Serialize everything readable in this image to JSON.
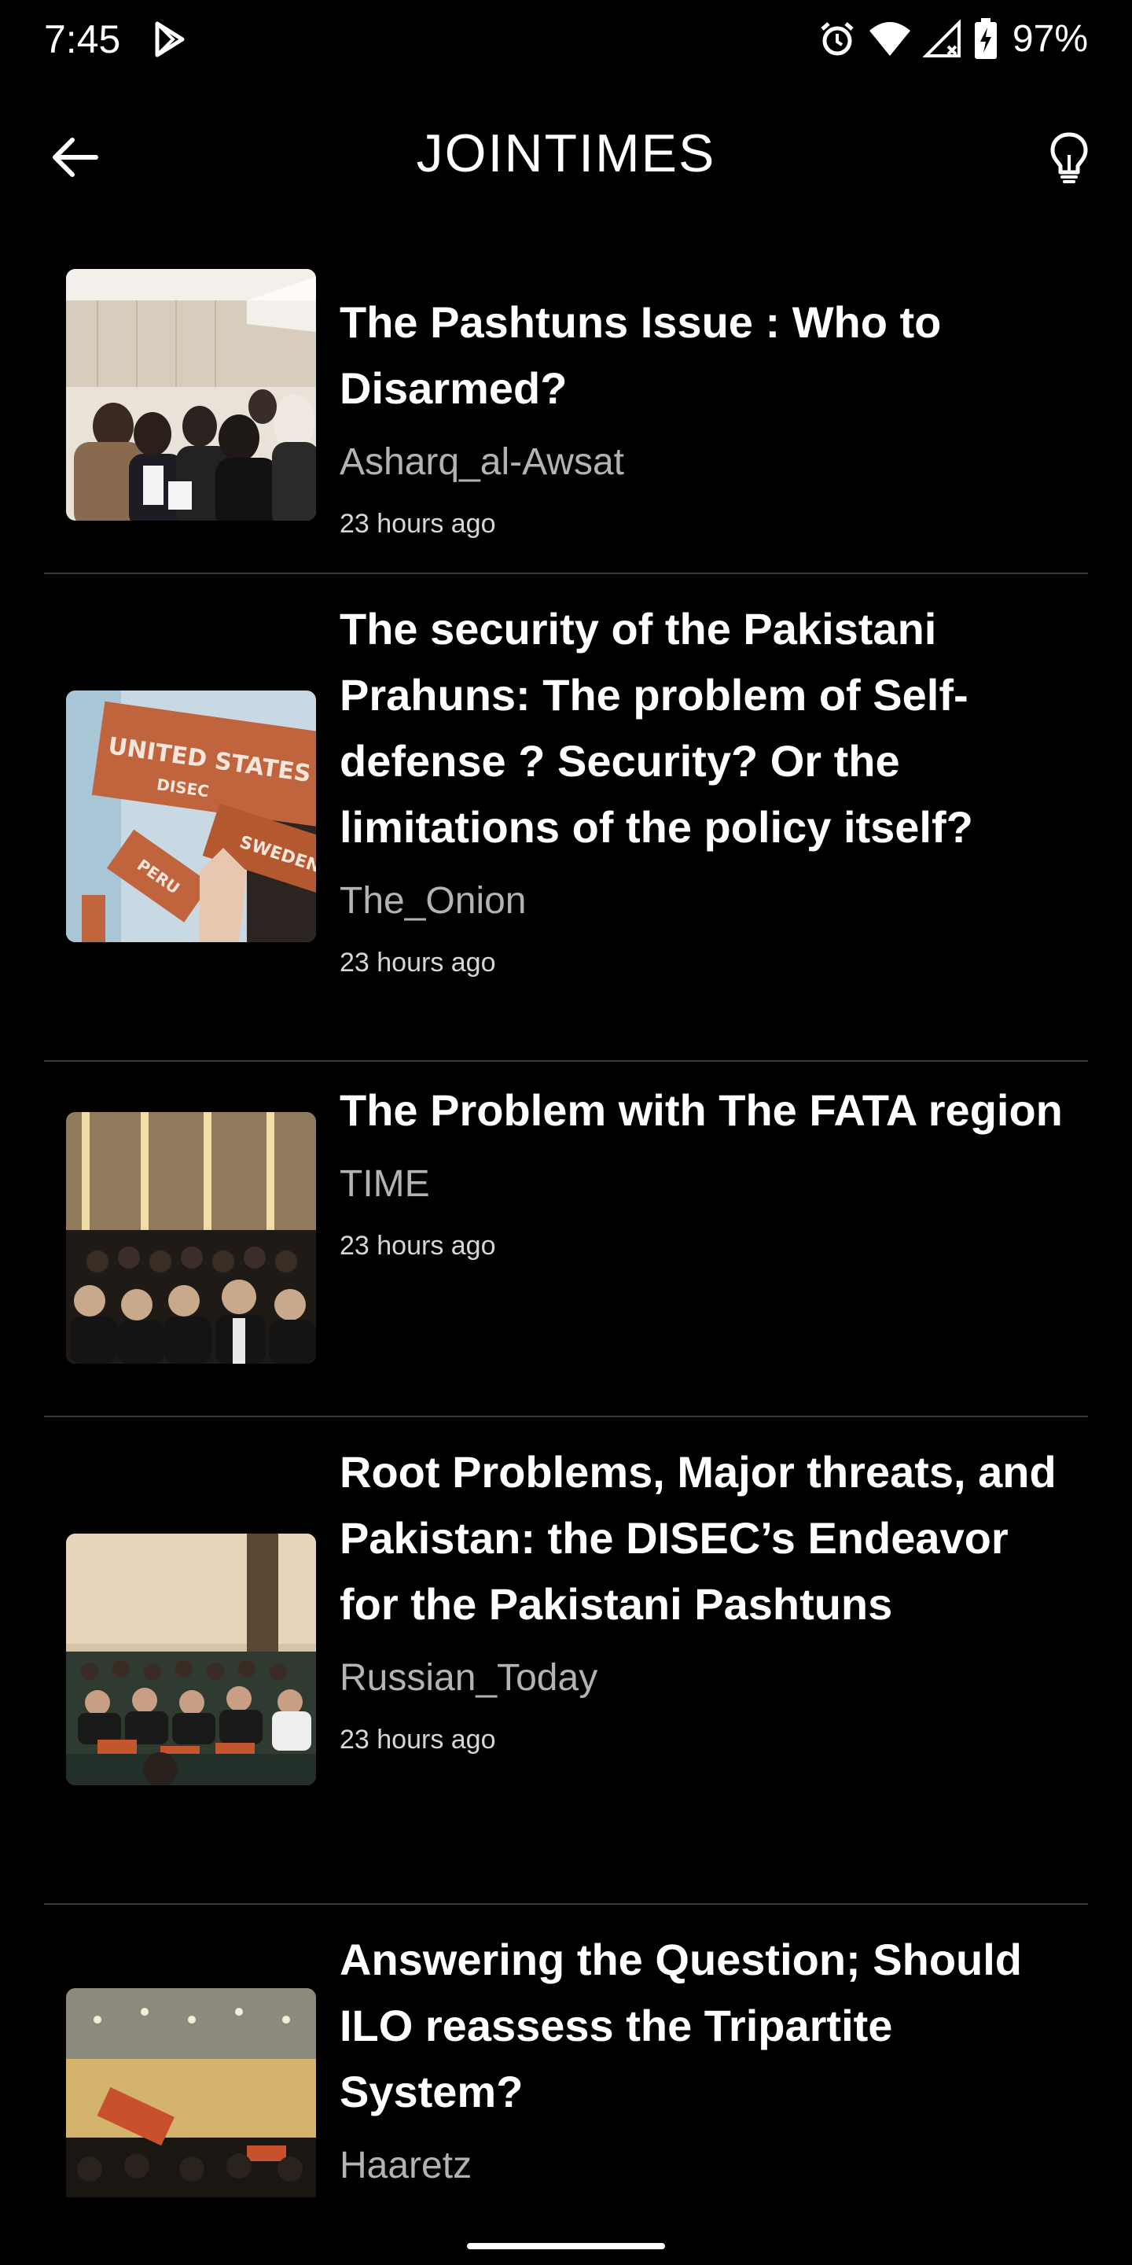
{
  "status_bar": {
    "time": "7:45",
    "battery_percent": "97%",
    "icons": [
      "play-store-icon",
      "alarm-icon",
      "wifi-icon",
      "signal-icon",
      "battery-charging-icon"
    ]
  },
  "app_bar": {
    "title": "JOINTIMES",
    "left_icon": "back-arrow-icon",
    "right_icon": "lightbulb-icon"
  },
  "articles": [
    {
      "title": "The Pashtuns Issue : Who to Disarmed?",
      "source": "Asharq_al-Awsat",
      "time": "23 hours ago"
    },
    {
      "title": "The security of the Pakistani Prahuns: The problem of Self-defense ? Security? Or the limitations of the policy itself?",
      "source": "The_Onion",
      "time": "23 hours ago"
    },
    {
      "title": "The Problem with The FATA region",
      "source": "TIME",
      "time": "23 hours ago"
    },
    {
      "title": "Root Problems, Major threats, and Pakistan: the DISEC’s Endeavor for the Pakistani Pashtuns",
      "source": "Russian_Today",
      "time": "23 hours ago"
    },
    {
      "title": "Answering the Question; Should ILO reassess the Tripartite System?",
      "source": "Haaretz",
      "time": ""
    }
  ],
  "thumb_text": {
    "article_2_placard_1": "UNITED STATES",
    "article_2_placard_1_sub": "DISEC",
    "article_2_placard_2": "SWEDEN",
    "article_2_placard_3": "PERU"
  },
  "colors": {
    "background": "#000000",
    "text_primary": "#ffffff",
    "text_secondary": "#b3b3b3",
    "divider": "#3a3a3a"
  }
}
